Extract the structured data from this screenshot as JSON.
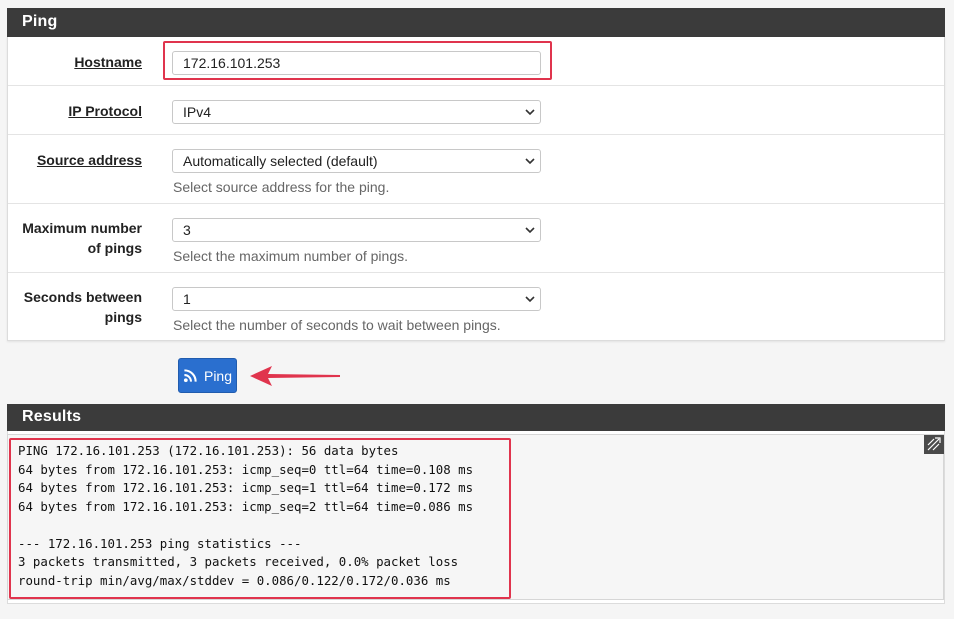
{
  "ping_panel": {
    "title": "Ping"
  },
  "form": {
    "hostname": {
      "label": "Hostname",
      "value": "172.16.101.253"
    },
    "ip_protocol": {
      "label": "IP Protocol",
      "value": "IPv4"
    },
    "source_address": {
      "label": "Source address",
      "value": "Automatically selected (default)",
      "help": "Select source address for the ping."
    },
    "max_pings": {
      "label_line1": "Maximum number",
      "label_line2": "of pings",
      "value": "3",
      "help": "Select the maximum number of pings."
    },
    "seconds_between": {
      "label_line1": "Seconds between",
      "label_line2": "pings",
      "value": "1",
      "help": "Select the number of seconds to wait between pings."
    }
  },
  "ping_button": {
    "label": "Ping",
    "icon": "rss-icon"
  },
  "results_panel": {
    "title": "Results",
    "lines": [
      "PING 172.16.101.253 (172.16.101.253): 56 data bytes",
      "64 bytes from 172.16.101.253: icmp_seq=0 ttl=64 time=0.108 ms",
      "64 bytes from 172.16.101.253: icmp_seq=1 ttl=64 time=0.172 ms",
      "64 bytes from 172.16.101.253: icmp_seq=2 ttl=64 time=0.086 ms",
      "",
      "--- 172.16.101.253 ping statistics ---",
      "3 packets transmitted, 3 packets received, 0.0% packet loss",
      "round-trip min/avg/max/stddev = 0.086/0.122/0.172/0.036 ms"
    ]
  },
  "colors": {
    "header_bg": "#3b3b3b",
    "button_bg": "#2a6fcf",
    "highlight": "#e0344d"
  }
}
